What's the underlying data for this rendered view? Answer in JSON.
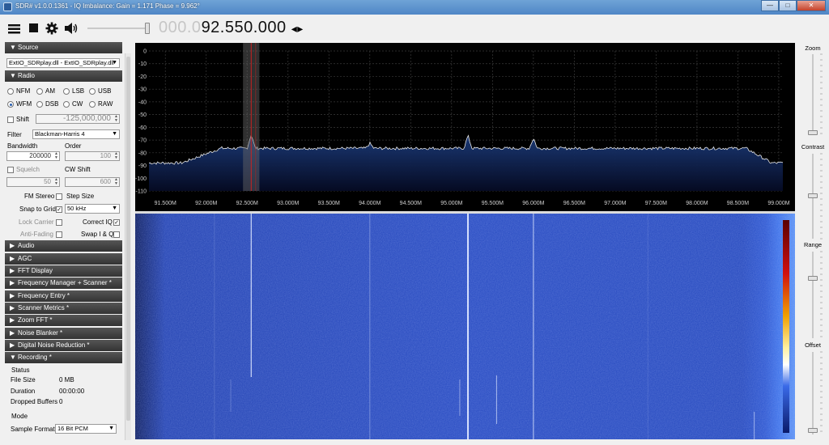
{
  "window": {
    "title": "SDR# v1.0.0.1361 - IQ Imbalance: Gain = 1.171 Phase = 9.962°",
    "minimize": "—",
    "maximize": "□",
    "close": "✕"
  },
  "toolbar": {
    "freq_dim": "000.0",
    "freq_bright": "92.550.000",
    "freq_arrows": "◂▸"
  },
  "source": {
    "header": "Source",
    "device": "ExtIO_SDRplay.dll - ExtIO_SDRplay.dll"
  },
  "radio": {
    "header": "Radio",
    "modes": [
      "NFM",
      "AM",
      "LSB",
      "USB",
      "WFM",
      "DSB",
      "CW",
      "RAW"
    ],
    "selected_mode": "WFM",
    "shift_label": "Shift",
    "shift_value": "-125,000,000",
    "filter_label": "Filter",
    "filter_value": "Blackman-Harris 4",
    "bandwidth_label": "Bandwidth",
    "bandwidth_value": "200000",
    "order_label": "Order",
    "order_value": "100",
    "squelch_label": "Squelch",
    "squelch_value": "50",
    "cw_shift_label": "CW Shift",
    "cw_shift_value": "600",
    "fm_stereo_label": "FM Stereo",
    "step_size_label": "Step Size",
    "snap_label": "Snap to Grid",
    "step_value": "50 kHz",
    "lock_carrier_label": "Lock Carrier",
    "correct_iq_label": "Correct IQ",
    "anti_fading_label": "Anti-Fading",
    "swap_iq_label": "Swap I & Q"
  },
  "collapsed_sections": [
    "Audio",
    "AGC",
    "FFT Display",
    "Frequency Manager + Scanner *",
    "Frequency Entry *",
    "Scanner Metrics *",
    "Zoom FFT *",
    "Noise Blanker *",
    "Digital Noise Reduction *"
  ],
  "recording": {
    "header": "Recording *",
    "status_label": "Status",
    "file_size_label": "File Size",
    "file_size_value": "0 MB",
    "duration_label": "Duration",
    "duration_value": "00:00:00",
    "dropped_label": "Dropped Buffers",
    "dropped_value": "0",
    "mode_label": "Mode",
    "sample_format_label": "Sample Format",
    "sample_format_value": "16 Bit PCM"
  },
  "spectrum": {
    "y_ticks": [
      "0",
      "-10",
      "-20",
      "-30",
      "-40",
      "-50",
      "-60",
      "-70",
      "-80",
      "-90",
      "-100",
      "-110"
    ],
    "x_ticks": [
      "91.500M",
      "92.000M",
      "92.500M",
      "93.000M",
      "93.500M",
      "94.000M",
      "94.500M",
      "95.000M",
      "95.500M",
      "96.000M",
      "96.500M",
      "97.000M",
      "97.500M",
      "98.000M",
      "98.500M",
      "99.000M"
    ],
    "tuned_frequency_mhz": 92.55,
    "trace_color": "#e8e8e8",
    "fill_color": "#1b3a78",
    "cursor_color": "#cc2222"
  },
  "right_panel": {
    "zoom_label": "Zoom",
    "contrast_label": "Contrast",
    "range_label": "Range",
    "offset_label": "Offset"
  }
}
